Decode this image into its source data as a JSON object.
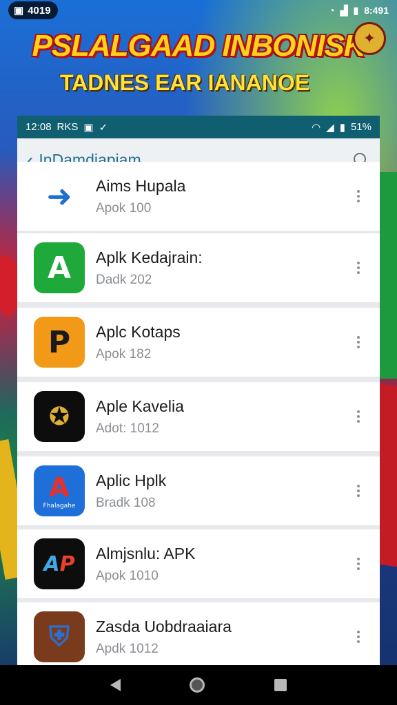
{
  "top_status": {
    "left": "4019",
    "right": "8:491"
  },
  "banner": {
    "title": "PSLALGAAD INBONISK",
    "subtitle": "TADNES EAR IANANOE"
  },
  "phone_status": {
    "time": "12:08",
    "carrier": "RKS",
    "battery": "51%"
  },
  "appbar": {
    "title": "InDamdiapiam"
  },
  "apps": [
    {
      "name": "Aims Hupala",
      "sub": "Apok 100",
      "icon": "blue-arrow-icon",
      "color": "#1d6fd1"
    },
    {
      "name": "Aplk Kedajrain:",
      "sub": "Dadk 202",
      "icon": "green-a-icon",
      "color": "#1fa93a"
    },
    {
      "name": "Aplc Kotaps",
      "sub": "Apok 182",
      "icon": "orange-p-icon",
      "color": "#f29a17"
    },
    {
      "name": "Aple Kavelia",
      "sub": "Adot: 1012",
      "icon": "emblem-icon",
      "color": "#0d0d0d"
    },
    {
      "name": "Aplic Hplk",
      "sub": "Bradk 108",
      "icon": "blue-a-icon",
      "color": "#1f6fd8",
      "icon_label": "Fhalagahe"
    },
    {
      "name": "Almjsnlu: APK",
      "sub": "Apok 1010",
      "icon": "ap-icon",
      "color": "#0d0d0d"
    },
    {
      "name": "Zasda Uobdraaiara",
      "sub": "Apdk 1012",
      "icon": "shield-icon",
      "color": "#7a3b1d"
    }
  ]
}
